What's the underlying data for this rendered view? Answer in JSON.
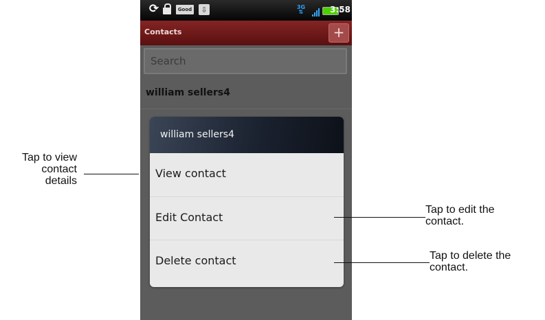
{
  "status_bar": {
    "icons": [
      "sync-icon",
      "lock-icon",
      "good-icon",
      "usb-icon",
      "3g-icon",
      "signal-icon",
      "battery-icon"
    ],
    "good_label": "Good",
    "network_label": "3G",
    "clock": "3:58"
  },
  "app": {
    "title": "Contacts",
    "add_label": "+",
    "accent_color": "#7a1c1c"
  },
  "search": {
    "placeholder": "Search",
    "value": ""
  },
  "contacts": [
    {
      "name": "william  sellers4"
    }
  ],
  "dialog": {
    "title": "william  sellers4",
    "items": [
      {
        "label": "View contact"
      },
      {
        "label": "Edit Contact"
      },
      {
        "label": "Delete contact"
      }
    ]
  },
  "annotations": {
    "view": [
      "Tap to view",
      "contact",
      "details"
    ],
    "edit": [
      "Tap to edit the",
      "contact."
    ],
    "delete": [
      "Tap to delete the",
      "contact."
    ]
  }
}
